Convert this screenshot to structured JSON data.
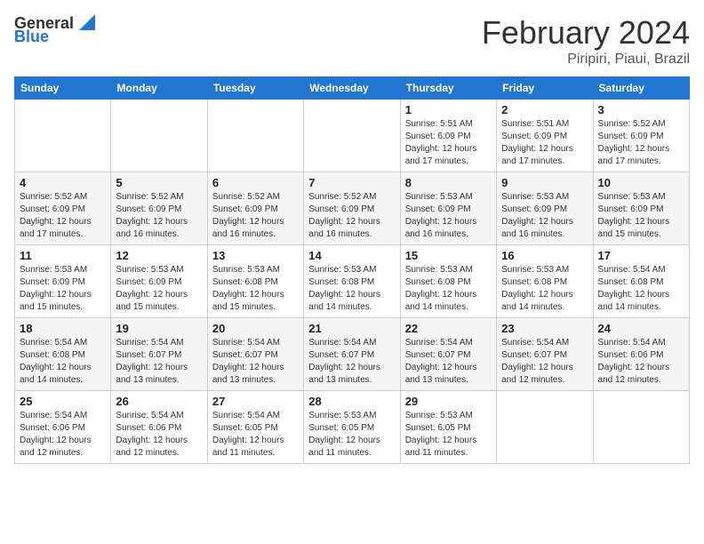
{
  "header": {
    "logo": {
      "general": "General",
      "blue": "Blue"
    },
    "title": "February 2024",
    "location": "Piripiri, Piaui, Brazil"
  },
  "days_of_week": [
    "Sunday",
    "Monday",
    "Tuesday",
    "Wednesday",
    "Thursday",
    "Friday",
    "Saturday"
  ],
  "weeks": [
    [
      {
        "day": "",
        "info": ""
      },
      {
        "day": "",
        "info": ""
      },
      {
        "day": "",
        "info": ""
      },
      {
        "day": "",
        "info": ""
      },
      {
        "day": "1",
        "info": "Sunrise: 5:51 AM\nSunset: 6:09 PM\nDaylight: 12 hours and 17 minutes."
      },
      {
        "day": "2",
        "info": "Sunrise: 5:51 AM\nSunset: 6:09 PM\nDaylight: 12 hours and 17 minutes."
      },
      {
        "day": "3",
        "info": "Sunrise: 5:52 AM\nSunset: 6:09 PM\nDaylight: 12 hours and 17 minutes."
      }
    ],
    [
      {
        "day": "4",
        "info": "Sunrise: 5:52 AM\nSunset: 6:09 PM\nDaylight: 12 hours and 17 minutes."
      },
      {
        "day": "5",
        "info": "Sunrise: 5:52 AM\nSunset: 6:09 PM\nDaylight: 12 hours and 16 minutes."
      },
      {
        "day": "6",
        "info": "Sunrise: 5:52 AM\nSunset: 6:09 PM\nDaylight: 12 hours and 16 minutes."
      },
      {
        "day": "7",
        "info": "Sunrise: 5:52 AM\nSunset: 6:09 PM\nDaylight: 12 hours and 16 minutes."
      },
      {
        "day": "8",
        "info": "Sunrise: 5:53 AM\nSunset: 6:09 PM\nDaylight: 12 hours and 16 minutes."
      },
      {
        "day": "9",
        "info": "Sunrise: 5:53 AM\nSunset: 6:09 PM\nDaylight: 12 hours and 16 minutes."
      },
      {
        "day": "10",
        "info": "Sunrise: 5:53 AM\nSunset: 6:09 PM\nDaylight: 12 hours and 15 minutes."
      }
    ],
    [
      {
        "day": "11",
        "info": "Sunrise: 5:53 AM\nSunset: 6:09 PM\nDaylight: 12 hours and 15 minutes."
      },
      {
        "day": "12",
        "info": "Sunrise: 5:53 AM\nSunset: 6:09 PM\nDaylight: 12 hours and 15 minutes."
      },
      {
        "day": "13",
        "info": "Sunrise: 5:53 AM\nSunset: 6:08 PM\nDaylight: 12 hours and 15 minutes."
      },
      {
        "day": "14",
        "info": "Sunrise: 5:53 AM\nSunset: 6:08 PM\nDaylight: 12 hours and 14 minutes."
      },
      {
        "day": "15",
        "info": "Sunrise: 5:53 AM\nSunset: 6:08 PM\nDaylight: 12 hours and 14 minutes."
      },
      {
        "day": "16",
        "info": "Sunrise: 5:53 AM\nSunset: 6:08 PM\nDaylight: 12 hours and 14 minutes."
      },
      {
        "day": "17",
        "info": "Sunrise: 5:54 AM\nSunset: 6:08 PM\nDaylight: 12 hours and 14 minutes."
      }
    ],
    [
      {
        "day": "18",
        "info": "Sunrise: 5:54 AM\nSunset: 6:08 PM\nDaylight: 12 hours and 14 minutes."
      },
      {
        "day": "19",
        "info": "Sunrise: 5:54 AM\nSunset: 6:07 PM\nDaylight: 12 hours and 13 minutes."
      },
      {
        "day": "20",
        "info": "Sunrise: 5:54 AM\nSunset: 6:07 PM\nDaylight: 12 hours and 13 minutes."
      },
      {
        "day": "21",
        "info": "Sunrise: 5:54 AM\nSunset: 6:07 PM\nDaylight: 12 hours and 13 minutes."
      },
      {
        "day": "22",
        "info": "Sunrise: 5:54 AM\nSunset: 6:07 PM\nDaylight: 12 hours and 13 minutes."
      },
      {
        "day": "23",
        "info": "Sunrise: 5:54 AM\nSunset: 6:07 PM\nDaylight: 12 hours and 12 minutes."
      },
      {
        "day": "24",
        "info": "Sunrise: 5:54 AM\nSunset: 6:06 PM\nDaylight: 12 hours and 12 minutes."
      }
    ],
    [
      {
        "day": "25",
        "info": "Sunrise: 5:54 AM\nSunset: 6:06 PM\nDaylight: 12 hours and 12 minutes."
      },
      {
        "day": "26",
        "info": "Sunrise: 5:54 AM\nSunset: 6:06 PM\nDaylight: 12 hours and 12 minutes."
      },
      {
        "day": "27",
        "info": "Sunrise: 5:54 AM\nSunset: 6:05 PM\nDaylight: 12 hours and 11 minutes."
      },
      {
        "day": "28",
        "info": "Sunrise: 5:53 AM\nSunset: 6:05 PM\nDaylight: 12 hours and 11 minutes."
      },
      {
        "day": "29",
        "info": "Sunrise: 5:53 AM\nSunset: 6:05 PM\nDaylight: 12 hours and 11 minutes."
      },
      {
        "day": "",
        "info": ""
      },
      {
        "day": "",
        "info": ""
      }
    ]
  ]
}
